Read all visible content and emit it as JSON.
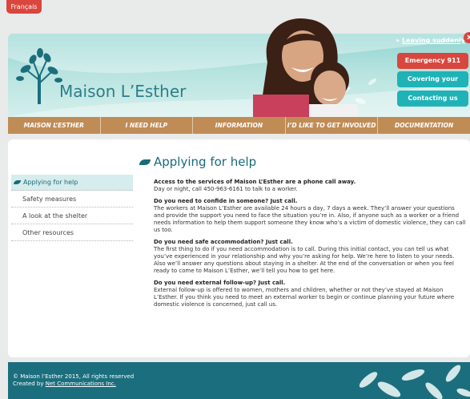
{
  "language_button": "Français",
  "header": {
    "logo_text": "Maison L’Esther",
    "leave_link_prefix": "»",
    "leave_link": "Leaving suddenly",
    "emergency": "Emergency 911",
    "covering_tracks": "Covering your tracks",
    "contact": "Contacting us"
  },
  "nav": [
    "MAISON L’ESTHER",
    "I NEED HELP",
    "INFORMATION",
    "I’D LIKE TO GET INVOLVED",
    "DOCUMENTATION"
  ],
  "sidebar": [
    "Applying for help",
    "Safety measures",
    "A look at the shelter",
    "Other resources"
  ],
  "page_title": "Applying for help",
  "article": {
    "s1_title": "Access to the services of Maison L’Esther are a phone call away.",
    "s1_body": "Day or night, call 450-963-6161 to talk to a worker.",
    "s2_title": "Do you need to confide in someone?  Just call.",
    "s2_body": "The workers at Maison L’Esther are available 24 hours a day, 7 days a week. They’ll answer your questions and provide the support you need to face the situation you’re in.  Also, if anyone such as a worker or a friend needs information to help them support someone they know who’s a victim of domestic violence, they can call us too.",
    "s3_title": "Do you need safe accommodation? Just call.",
    "s3_body": "The first thing to do if you need accommodation is to call.  During this initial contact, you can tell us what you’ve experienced in your relationship and why you’re asking for help. We’re here to listen to your needs. Also we’ll answer any questions about staying in a shelter. At the end of the conversation or when you feel ready to come to Maison L’Esther, we’ll tell you how to get here.",
    "s4_title": "Do you need external follow-up? Just call.",
    "s4_body": "External follow-up is offered to women, mothers and children, whether or not they’ve stayed at Maison L’Esther. If you think you need to meet an external worker to begin or continue planning your future where domestic violence is concerned, just call us."
  },
  "footer": {
    "copyright": "© Maison l’Esther 2015, All rights reserved",
    "created_by": "Created by",
    "company": "Net Communications Inc."
  },
  "colors": {
    "teal": "#186b7a",
    "red": "#d9463e",
    "cyan_button": "#1fb2b7",
    "nav_brown": "#c08c56"
  }
}
